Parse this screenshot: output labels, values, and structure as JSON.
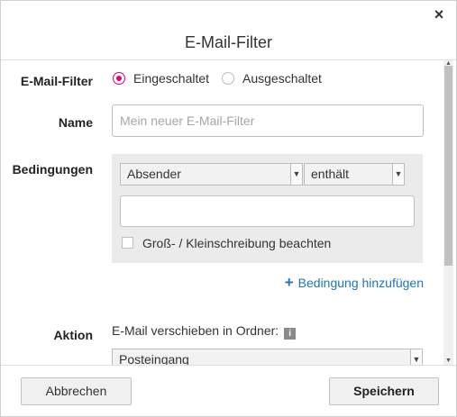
{
  "dialog": {
    "title": "E-Mail-Filter",
    "close_glyph": "×"
  },
  "form": {
    "status": {
      "label": "E-Mail-Filter",
      "options": [
        "Eingeschaltet",
        "Ausgeschaltet"
      ],
      "selected": "Eingeschaltet"
    },
    "name": {
      "label": "Name",
      "placeholder": "Mein neuer E-Mail-Filter",
      "value": ""
    },
    "conditions": {
      "label": "Bedingungen",
      "field_select": "Absender",
      "operator_select": "enthält",
      "value": "",
      "case_label": "Groß- / Kleinschreibung beachten",
      "case_checked": false,
      "add_label": "Bedingung hinzufügen"
    },
    "action": {
      "label": "Aktion",
      "text": "E-Mail verschieben in Ordner:",
      "folder_select": "Posteingang"
    }
  },
  "footer": {
    "cancel_label": "Abbrechen",
    "save_label": "Speichern"
  },
  "colors": {
    "accent": "#e20074",
    "link": "#1f75b8"
  },
  "icons": {
    "close": "close-icon",
    "info": "info-icon",
    "add": "plus-icon",
    "dropdown": "chevron-down-icon"
  }
}
